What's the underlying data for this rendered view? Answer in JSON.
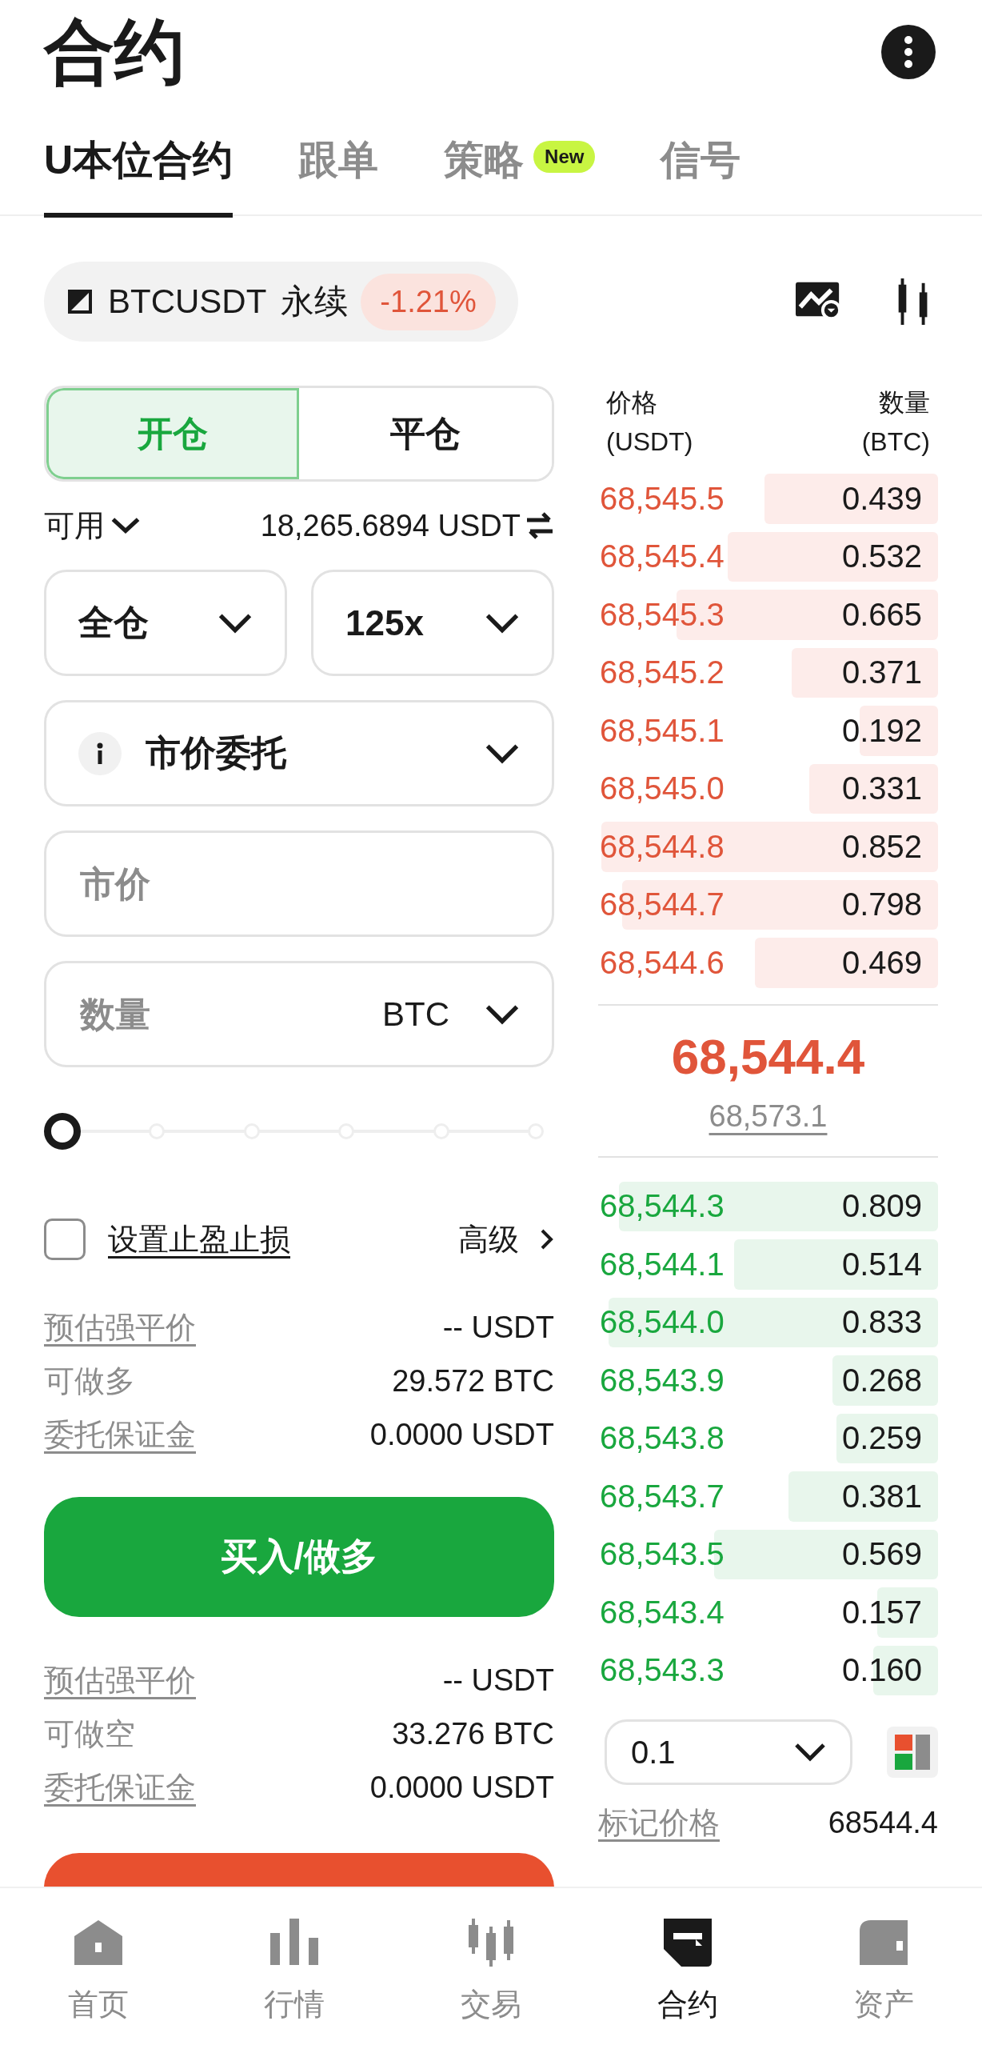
{
  "header": {
    "title": "合约"
  },
  "tabs": [
    {
      "label": "U本位合约",
      "selected": true
    },
    {
      "label": "跟单",
      "selected": false
    },
    {
      "label": "策略",
      "selected": false,
      "badge": "New"
    },
    {
      "label": "信号",
      "selected": false
    }
  ],
  "symbol": {
    "name": "BTCUSDT",
    "type": "永续",
    "change": "-1.21%"
  },
  "order_form": {
    "sides": [
      {
        "label": "开仓",
        "selected": true
      },
      {
        "label": "平仓",
        "selected": false
      }
    ],
    "available": {
      "label": "可用",
      "value": "18,265.6894 USDT"
    },
    "margin_mode": "全仓",
    "leverage": "125x",
    "order_type": "市价委托",
    "price_field": {
      "placeholder": "市价"
    },
    "quantity_field": {
      "placeholder": "数量",
      "unit": "BTC"
    },
    "slider": {
      "level": 0
    },
    "tp_sl": {
      "label": "设置止盈止损",
      "checked": false
    },
    "advanced": "高级",
    "buy_info": [
      {
        "label": "预估强平价",
        "value": "-- USDT",
        "underlined": true
      },
      {
        "label": "可做多",
        "value": "29.572 BTC",
        "underlined": false
      },
      {
        "label": "委托保证金",
        "value": "0.0000 USDT",
        "underlined": true
      }
    ],
    "buy_button": "买入/做多",
    "sell_info": [
      {
        "label": "预估强平价",
        "value": "-- USDT",
        "underlined": true
      },
      {
        "label": "可做空",
        "value": "33.276 BTC",
        "underlined": false
      },
      {
        "label": "委托保证金",
        "value": "0.0000 USDT",
        "underlined": true
      }
    ]
  },
  "order_book": {
    "price_header": "价格",
    "price_unit": "(USDT)",
    "qty_header": "数量",
    "qty_unit": "(BTC)",
    "asks": [
      {
        "price": "68,545.5",
        "qty": "0.439",
        "level": 0.51
      },
      {
        "price": "68,545.4",
        "qty": "0.532",
        "level": 0.62
      },
      {
        "price": "68,545.3",
        "qty": "0.665",
        "level": 0.77
      },
      {
        "price": "68,545.2",
        "qty": "0.371",
        "level": 0.43
      },
      {
        "price": "68,545.1",
        "qty": "0.192",
        "level": 0.23
      },
      {
        "price": "68,545.0",
        "qty": "0.331",
        "level": 0.38
      },
      {
        "price": "68,544.8",
        "qty": "0.852",
        "level": 0.99
      },
      {
        "price": "68,544.7",
        "qty": "0.798",
        "level": 0.93
      },
      {
        "price": "68,544.6",
        "qty": "0.469",
        "level": 0.54
      }
    ],
    "last_price": "68,544.4",
    "mark_price": "68,573.1",
    "bids": [
      {
        "price": "68,544.3",
        "qty": "0.809",
        "level": 0.94
      },
      {
        "price": "68,544.1",
        "qty": "0.514",
        "level": 0.6
      },
      {
        "price": "68,544.0",
        "qty": "0.833",
        "level": 0.97
      },
      {
        "price": "68,543.9",
        "qty": "0.268",
        "level": 0.31
      },
      {
        "price": "68,543.8",
        "qty": "0.259",
        "level": 0.3
      },
      {
        "price": "68,543.7",
        "qty": "0.381",
        "level": 0.44
      },
      {
        "price": "68,543.5",
        "qty": "0.569",
        "level": 0.66
      },
      {
        "price": "68,543.4",
        "qty": "0.157",
        "level": 0.18
      },
      {
        "price": "68,543.3",
        "qty": "0.160",
        "level": 0.19
      }
    ],
    "depth": "0.1",
    "stats": [
      {
        "label": "标记价格",
        "value": "68544.4"
      }
    ]
  },
  "nav": [
    {
      "label": "首页",
      "kind": "home",
      "selected": false
    },
    {
      "label": "行情",
      "kind": "markets",
      "selected": false
    },
    {
      "label": "交易",
      "kind": "trade",
      "selected": false
    },
    {
      "label": "合约",
      "kind": "futures",
      "selected": true
    },
    {
      "label": "资产",
      "kind": "assets",
      "selected": false
    }
  ]
}
